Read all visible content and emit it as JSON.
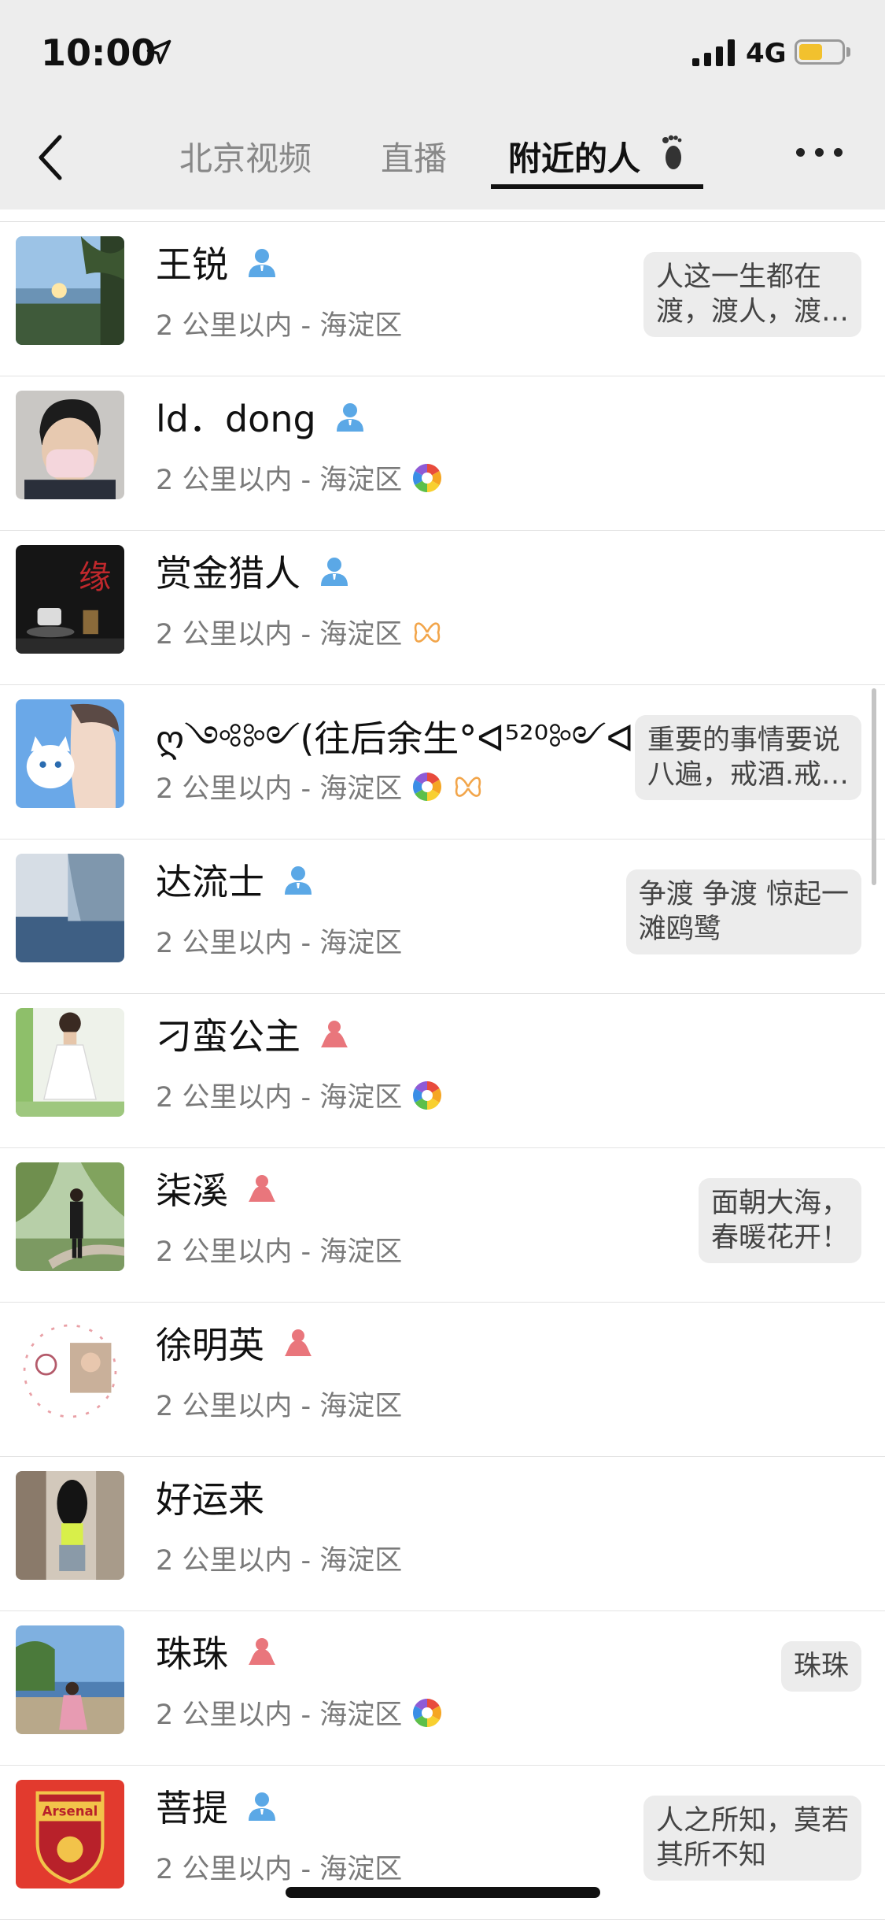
{
  "status": {
    "time": "10:00",
    "network": "4G",
    "battery_level": 0.55
  },
  "nav": {
    "tabs": [
      "北京视频",
      "直播",
      "附近的人"
    ],
    "active_tab": 2
  },
  "people": [
    {
      "name": "王锐",
      "gender": "male",
      "distance": "2 公里以内 - 海淀区",
      "badges": [],
      "signature": "人这一生都在\n渡，渡人，渡…",
      "avatar": "lake-sunset"
    },
    {
      "name": "ld．dong",
      "gender": "male",
      "distance": "2 公里以内 - 海淀区",
      "badges": [
        "aperture"
      ],
      "signature": "",
      "avatar": "masked-person"
    },
    {
      "name": "赏金猎人",
      "gender": "male",
      "distance": "2 公里以内 - 海淀区",
      "badges": [
        "butterfly"
      ],
      "signature": "",
      "avatar": "dark-still-life"
    },
    {
      "name": "ღ༺༻(往后余生°ᐊ⁵²⁰༻ᐊ",
      "gender": "male",
      "distance": "2 公里以内 - 海淀区",
      "badges": [
        "aperture",
        "butterfly"
      ],
      "signature": "重要的事情要说\n八遍，戒酒.戒…",
      "avatar": "anime-cat"
    },
    {
      "name": "达流士",
      "gender": "male",
      "distance": "2 公里以内 - 海淀区",
      "badges": [],
      "signature": "争渡 争渡 惊起一\n滩鸥鹭",
      "avatar": "sea-glacier"
    },
    {
      "name": "刁蛮公主",
      "gender": "female",
      "distance": "2 公里以内 - 海淀区",
      "badges": [
        "aperture"
      ],
      "signature": "",
      "avatar": "white-dress"
    },
    {
      "name": "柒溪",
      "gender": "female",
      "distance": "2 公里以内 - 海淀区",
      "badges": [],
      "signature": "面朝大海，\n春暖花开！",
      "avatar": "park-walk"
    },
    {
      "name": "徐明英",
      "gender": "female",
      "distance": "2 公里以内 - 海淀区",
      "badges": [],
      "signature": "",
      "avatar": "heart-frame"
    },
    {
      "name": "好运来",
      "gender": "none",
      "distance": "2 公里以内 - 海淀区",
      "badges": [],
      "signature": "",
      "avatar": "street-back"
    },
    {
      "name": "珠珠",
      "gender": "female",
      "distance": "2 公里以内 - 海淀区",
      "badges": [
        "aperture"
      ],
      "signature": "珠珠",
      "avatar": "lakeside"
    },
    {
      "name": "菩提",
      "gender": "male",
      "distance": "2 公里以内 - 海淀区",
      "badges": [],
      "signature": "人之所知，莫若\n其所不知",
      "avatar": "arsenal-logo",
      "avatar_text": "Arsenal"
    }
  ],
  "colors": {
    "male": "#5ba8e6",
    "female": "#e9767c",
    "butterfly": "#f2a54a"
  }
}
